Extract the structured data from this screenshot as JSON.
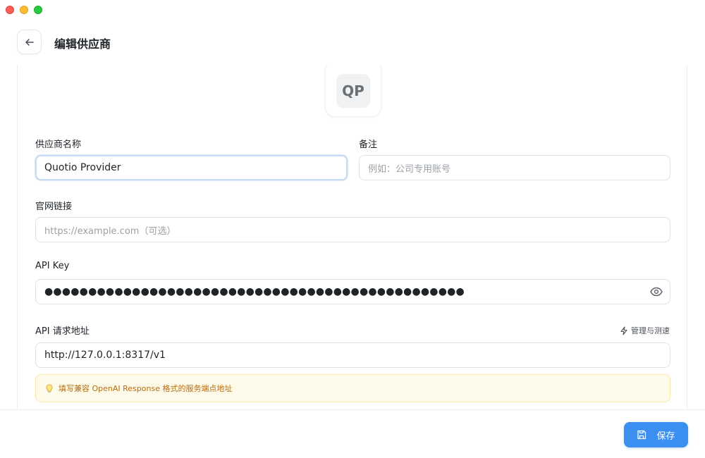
{
  "header": {
    "title": "编辑供应商"
  },
  "avatar": {
    "initials": "QP"
  },
  "form": {
    "name_label": "供应商名称",
    "name_value": "Quotio Provider",
    "note_label": "备注",
    "note_placeholder": "例如：公司专用账号",
    "website_label": "官网链接",
    "website_placeholder": "https://example.com（可选）",
    "apikey_label": "API Key",
    "apikey_masked": "●●●●●●●●●●●●●●●●●●●●●●●●●●●●●●●●●●●●●●●●●●●●●●●●",
    "endpoint_label": "API 请求地址",
    "manage_label": "管理与测速",
    "endpoint_value": "http://127.0.0.1:8317/v1",
    "tip_text": "填写兼容 OpenAI Response 格式的服务端点地址"
  },
  "footer": {
    "save_label": "保存"
  },
  "colors": {
    "accent": "#3b8ff0",
    "tip_bg": "#fffbeb",
    "tip_text": "#b86b0a"
  }
}
